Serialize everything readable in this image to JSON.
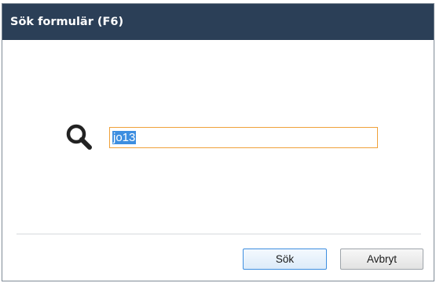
{
  "window": {
    "title": "Sök formulär (F6)"
  },
  "search": {
    "value": "jo13"
  },
  "buttons": {
    "search_label": "Sök",
    "cancel_label": "Avbryt"
  },
  "icons": {
    "search": "search-icon"
  },
  "colors": {
    "titlebar": "#2b3f57",
    "input_focus_border": "#f0a13a",
    "selection": "#3d8ee0"
  }
}
